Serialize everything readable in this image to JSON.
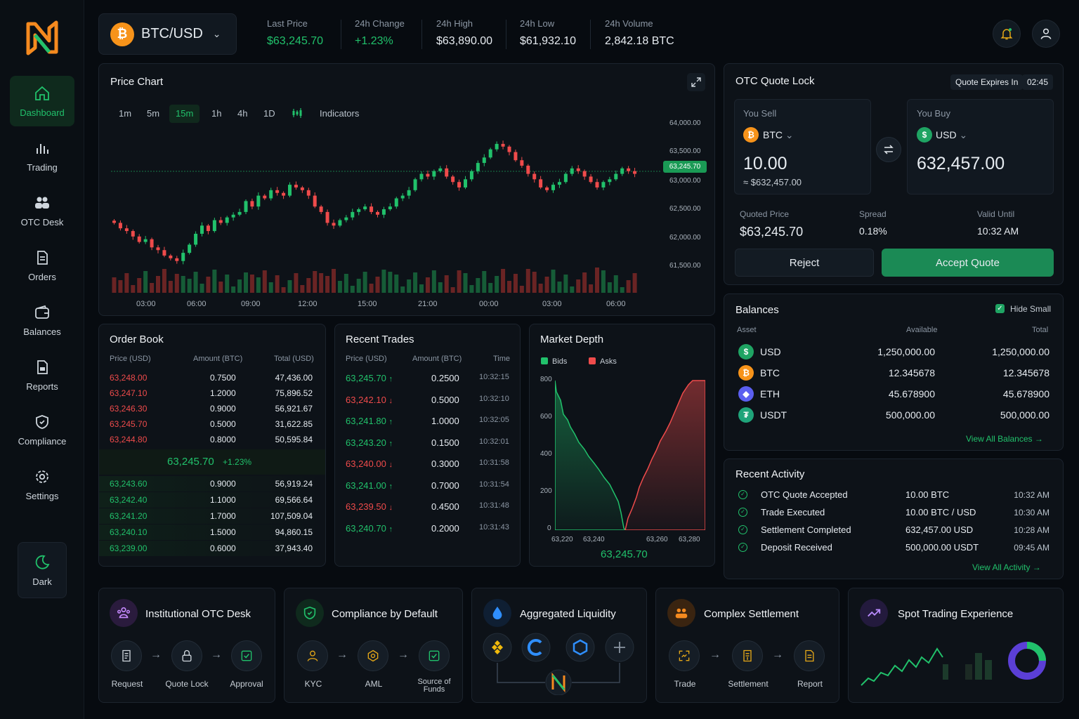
{
  "sidebar": {
    "items": [
      {
        "label": "Dashboard",
        "icon": "home-icon",
        "active": true
      },
      {
        "label": "Trading",
        "icon": "bar-chart-icon"
      },
      {
        "label": "OTC Desk",
        "icon": "users-icon"
      },
      {
        "label": "Orders",
        "icon": "document-icon"
      },
      {
        "label": "Balances",
        "icon": "wallet-icon"
      },
      {
        "label": "Reports",
        "icon": "report-icon"
      },
      {
        "label": "Compliance",
        "icon": "shield-icon"
      },
      {
        "label": "Settings",
        "icon": "gear-icon"
      }
    ],
    "theme_label": "Dark"
  },
  "header": {
    "pair": "BTC/USD",
    "stats": [
      {
        "label": "Last Price",
        "value": "$63,245.70",
        "tone": "green"
      },
      {
        "label": "24h Change",
        "value": "+1.23%",
        "tone": "green"
      },
      {
        "label": "24h High",
        "value": "$63,890.00",
        "tone": "white"
      },
      {
        "label": "24h Low",
        "value": "$61,932.10",
        "tone": "white"
      },
      {
        "label": "24h Volume",
        "value": "2,842.18 BTC",
        "tone": "white"
      }
    ]
  },
  "chart": {
    "title": "Price Chart",
    "timeframes": [
      "1m",
      "5m",
      "15m",
      "1h",
      "4h",
      "1D"
    ],
    "active_timeframe": "15m",
    "indicators_label": "Indicators",
    "y_ticks": [
      "64,000.00",
      "63,500.00",
      "63,000.00",
      "62,500.00",
      "62,000.00",
      "61,500.00"
    ],
    "x_ticks": [
      "03:00",
      "06:00",
      "09:00",
      "12:00",
      "15:00",
      "21:00",
      "00:00",
      "03:00",
      "06:00"
    ],
    "last_price_tag": "63,245.70"
  },
  "chart_data": {
    "type": "candlestick",
    "ylim": [
      61300,
      64200
    ],
    "last_price": 63245.7,
    "closes": [
      62300,
      62200,
      62150,
      62050,
      61950,
      62000,
      61850,
      61800,
      61700,
      61650,
      61600,
      61750,
      61900,
      62100,
      62250,
      62150,
      62350,
      62300,
      62400,
      62450,
      62500,
      62700,
      62600,
      62800,
      62750,
      62900,
      62850,
      62800,
      63000,
      62950,
      62900,
      62800,
      62600,
      62500,
      62300,
      62250,
      62350,
      62400,
      62500,
      62550,
      62600,
      62500,
      62450,
      62550,
      62600,
      62750,
      62800,
      62900,
      63100,
      63200,
      63150,
      63250,
      63300,
      63150,
      63050,
      62950,
      63100,
      63250,
      63400,
      63500,
      63650,
      63750,
      63700,
      63600,
      63450,
      63350,
      63200,
      63100,
      62950,
      62900,
      63000,
      63050,
      63200,
      63300,
      63250,
      63150,
      63050,
      62950,
      63050,
      63100,
      63200,
      63300,
      63250,
      63200
    ]
  },
  "order_book": {
    "title": "Order Book",
    "headers": [
      "Price (USD)",
      "Amount (BTC)",
      "Total (USD)"
    ],
    "asks": [
      [
        "63,248.00",
        "0.7500",
        "47,436.00"
      ],
      [
        "63,247.10",
        "1.2000",
        "75,896.52"
      ],
      [
        "63,246.30",
        "0.9000",
        "56,921.67"
      ],
      [
        "63,245.70",
        "0.5000",
        "31,622.85"
      ],
      [
        "63,244.80",
        "0.8000",
        "50,595.84"
      ]
    ],
    "mid_price": "63,245.70",
    "mid_change": "+1.23%",
    "bids": [
      [
        "63,243.60",
        "0.9000",
        "56,919.24"
      ],
      [
        "63,242.40",
        "1.1000",
        "69,566.64"
      ],
      [
        "63,241.20",
        "1.7000",
        "107,509.04"
      ],
      [
        "63,240.10",
        "1.5000",
        "94,860.15"
      ],
      [
        "63,239.00",
        "0.6000",
        "37,943.40"
      ]
    ]
  },
  "recent_trades": {
    "title": "Recent Trades",
    "headers": [
      "Price (USD)",
      "Amount (BTC)",
      "Time"
    ],
    "rows": [
      {
        "price": "63,245.70",
        "dir": "up",
        "amount": "0.2500",
        "time": "10:32:15"
      },
      {
        "price": "63,242.10",
        "dir": "down",
        "amount": "0.5000",
        "time": "10:32:10"
      },
      {
        "price": "63,241.80",
        "dir": "up",
        "amount": "1.0000",
        "time": "10:32:05"
      },
      {
        "price": "63,243.20",
        "dir": "up",
        "amount": "0.1500",
        "time": "10:32:01"
      },
      {
        "price": "63,240.00",
        "dir": "down",
        "amount": "0.3000",
        "time": "10:31:58"
      },
      {
        "price": "63,241.00",
        "dir": "up",
        "amount": "0.7000",
        "time": "10:31:54"
      },
      {
        "price": "63,239.50",
        "dir": "down",
        "amount": "0.4500",
        "time": "10:31:48"
      },
      {
        "price": "63,240.70",
        "dir": "up",
        "amount": "0.2000",
        "time": "10:31:43"
      }
    ]
  },
  "market_depth": {
    "title": "Market Depth",
    "legend": [
      "Bids",
      "Asks"
    ],
    "y_ticks": [
      "800",
      "600",
      "400",
      "200",
      "0"
    ],
    "x_ticks": [
      "63,220",
      "63,240",
      "63,260",
      "63,280"
    ],
    "mid_price": "63,245.70"
  },
  "otc": {
    "title": "OTC Quote Lock",
    "expires_label": "Quote Expires In",
    "expires_value": "02:45",
    "sell": {
      "label": "You Sell",
      "asset": "BTC",
      "amount": "10.00",
      "approx": "≈ $632,457.00"
    },
    "buy": {
      "label": "You Buy",
      "asset": "USD",
      "amount": "632,457.00"
    },
    "quoted_price": {
      "label": "Quoted Price",
      "value": "$63,245.70"
    },
    "spread": {
      "label": "Spread",
      "value": "0.18%"
    },
    "valid_until": {
      "label": "Valid Until",
      "value": "10:32 AM"
    },
    "reject_label": "Reject",
    "accept_label": "Accept Quote"
  },
  "balances": {
    "title": "Balances",
    "hide_small_label": "Hide Small",
    "headers": [
      "Asset",
      "Available",
      "Total"
    ],
    "rows": [
      {
        "asset": "USD",
        "available": "1,250,000.00",
        "total": "1,250,000.00",
        "color": "#1fa463",
        "glyph": "$"
      },
      {
        "asset": "BTC",
        "available": "12.345678",
        "total": "12.345678",
        "color": "#f7931a",
        "glyph": "₿"
      },
      {
        "asset": "ETH",
        "available": "45.678900",
        "total": "45.678900",
        "color": "#5b5ff0",
        "glyph": "◆"
      },
      {
        "asset": "USDT",
        "available": "500,000.00",
        "total": "500,000.00",
        "color": "#1fa47a",
        "glyph": "₮"
      }
    ],
    "view_all_label": "View All Balances →"
  },
  "activity": {
    "title": "Recent Activity",
    "rows": [
      {
        "event": "OTC Quote Accepted",
        "detail": "10.00 BTC",
        "time": "10:32 AM"
      },
      {
        "event": "Trade Executed",
        "detail": "10.00 BTC / USD",
        "time": "10:30 AM"
      },
      {
        "event": "Settlement Completed",
        "detail": "632,457.00 USD",
        "time": "10:28 AM"
      },
      {
        "event": "Deposit Received",
        "detail": "500,000.00 USDT",
        "time": "09:45 AM"
      }
    ],
    "view_all_label": "View All Activity →"
  },
  "features": [
    {
      "title": "Institutional OTC Desk",
      "steps": [
        "Request",
        "Quote Lock",
        "Approval"
      ]
    },
    {
      "title": "Compliance by Default",
      "steps": [
        "KYC",
        "AML",
        "Source of Funds"
      ]
    },
    {
      "title": "Aggregated Liquidity",
      "steps": []
    },
    {
      "title": "Complex Settlement",
      "steps": [
        "Trade",
        "Settlement",
        "Report"
      ]
    },
    {
      "title": "Spot Trading Experience",
      "steps": []
    }
  ],
  "colors": {
    "green": "#21c16b",
    "red": "#ef4b4b",
    "accent_button": "#1b8a55",
    "bg": "#070b10"
  }
}
